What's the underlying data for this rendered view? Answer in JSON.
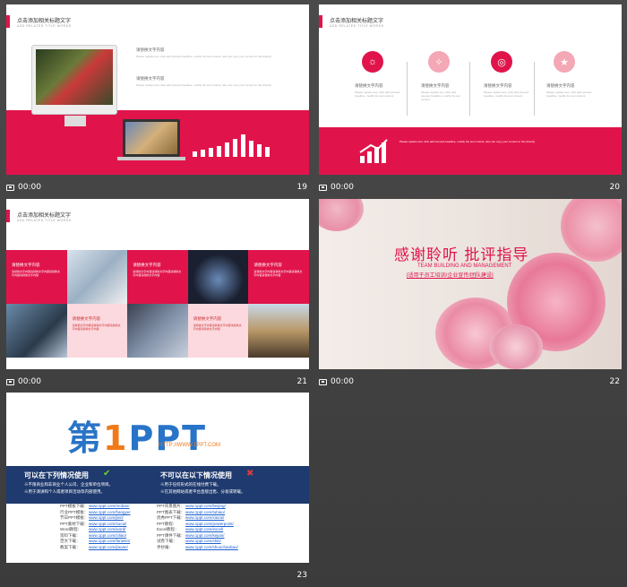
{
  "slides": [
    {
      "number": "19",
      "time": "00:00",
      "title": "点击添加相关标题文字",
      "subtitle": "ADD RELATED TITLE WORDS",
      "caption1": "请替换文字内容",
      "caption2": "请替换文字内容",
      "body_text": "Please replace text, click add relevant headline, modify the text content, also can copy your content to this directly."
    },
    {
      "number": "20",
      "time": "00:00",
      "title": "点击添加相关标题文字",
      "subtitle": "ADD RELATED TITLE WORDS",
      "items": [
        {
          "label": "请替换文字内容",
          "icon": "lightbulb-icon",
          "glyph": "☼",
          "color": "#e0144b"
        },
        {
          "label": "请替换文字内容",
          "icon": "drop-icon",
          "glyph": "✧",
          "color": "#f4a7b5"
        },
        {
          "label": "请替换文字内容",
          "icon": "target-icon",
          "glyph": "◎",
          "color": "#e0144b"
        },
        {
          "label": "请替换文字内容",
          "icon": "trophy-icon",
          "glyph": "★",
          "color": "#f4a7b5"
        }
      ],
      "item_text": "Please replace text, click add relevant headline, modify the text content.",
      "band_text": "Please replace text, click add relevant headline, modify the text content, also can copy your content to this directly."
    },
    {
      "number": "21",
      "time": "00:00",
      "title": "点击添加相关标题文字",
      "subtitle": "ADD RELATED TITLE WORDS",
      "cell_label": "请替换文字内容",
      "cell_text": "请替换文字内容请替换文字内容请替换文字内容请替换文字内容"
    },
    {
      "number": "22",
      "time": "00:00",
      "headline": "感谢聆听 批评指导",
      "english": "TEAM BUILDING AND MANAGEMENT",
      "tagline": "[适用于员工培训/企业宣传/团队建设]"
    },
    {
      "number": "23",
      "logo_text": "第1PPT",
      "logo_url": "HTTP://WWW.1PPT.COM",
      "allowed_title": "可以在下列情况使用",
      "allowed_lines": [
        "※不限商业和非商业个人公司、企业和单位项目。",
        "※用于演讲和个人或者项目活动等内部使用。"
      ],
      "forbidden_title": "不可以在以下情况使用",
      "forbidden_lines": [
        "※用于任何形式的在线付费下载。",
        "※在其他网站或者平台直接出售、分发或转载。"
      ],
      "left_links": [
        {
          "k": "PPT模板下载：",
          "v": "www.1ppt.com/moban/"
        },
        {
          "k": "行业PPT模板：",
          "v": "www.1ppt.com/hangye/"
        },
        {
          "k": "节日PPT模板：",
          "v": "www.1ppt.com/jieri/"
        },
        {
          "k": "PPT素材下载：",
          "v": "www.1ppt.com/sucai/"
        },
        {
          "k": "Word教程：",
          "v": "www.1ppt.com/word/"
        },
        {
          "k": "资料下载：",
          "v": "www.1ppt.com/ziliao/"
        },
        {
          "k": "范文下载：",
          "v": "www.1ppt.com/fanwen/"
        },
        {
          "k": "教案下载：",
          "v": "www.1ppt.com/jiaoan/"
        }
      ],
      "right_links": [
        {
          "k": "PPT背景图片：",
          "v": "www.1ppt.com/beijing/"
        },
        {
          "k": "PPT图表下载：",
          "v": "www.1ppt.com/tubiao/"
        },
        {
          "k": "优秀PPT下载：",
          "v": "www.1ppt.com/xiazai/"
        },
        {
          "k": "PPT教程：",
          "v": "www.1ppt.com/powerpoint/"
        },
        {
          "k": "Excel教程：",
          "v": "www.1ppt.com/excel/"
        },
        {
          "k": "PPT课件下载：",
          "v": "www.1ppt.com/kejian/"
        },
        {
          "k": "试卷下载：",
          "v": "www.1ppt.com/shiti/"
        },
        {
          "k": "手抄报：",
          "v": "www.1ppt.com/shouchaobao/"
        }
      ]
    }
  ],
  "colors": {
    "accent": "#e0144b",
    "navy": "#1f3a6e",
    "link": "#1a5fd0"
  }
}
